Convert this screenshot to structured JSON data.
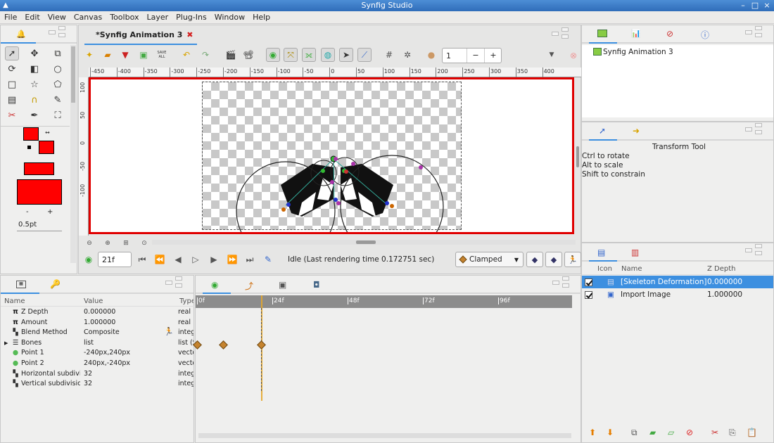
{
  "window": {
    "title": "Synfig Studio",
    "min": "–",
    "max": "□",
    "close": "×"
  },
  "menu": [
    "File",
    "Edit",
    "View",
    "Canvas",
    "Toolbox",
    "Layer",
    "Plug-Ins",
    "Window",
    "Help"
  ],
  "document_tab": {
    "label": "*Synfig Animation 3",
    "close": "✖"
  },
  "toolbar": {
    "save_all": "SAVE ALL",
    "onion_value": "1",
    "minus": "−",
    "plus": "+"
  },
  "ruler_h": [
    "-450",
    "-400",
    "-350",
    "-300",
    "-250",
    "-200",
    "-150",
    "-100",
    "-50",
    "0",
    "50",
    "100",
    "150",
    "200",
    "250",
    "300",
    "350",
    "400"
  ],
  "ruler_v": [
    "100",
    "50",
    "0",
    "-50",
    "-100"
  ],
  "colors": {
    "outline": "#ff0000",
    "fill": "#ff0000",
    "accent": "#3c8fe0",
    "canvas_border": "#e00000"
  },
  "brush_size": "0.5pt",
  "widths": {
    "minus": "-",
    "plus": "+"
  },
  "timebar": {
    "frame": "21f",
    "status": "Idle (Last rendering time 0.172751 sec)",
    "interpolation": "Clamped"
  },
  "params": {
    "headers": {
      "name": "Name",
      "value": "Value",
      "type": "Type"
    },
    "rows": [
      {
        "name": "Z Depth",
        "value": "0.000000",
        "type": "real",
        "icon": "pi-icon"
      },
      {
        "name": "Amount",
        "value": "1.000000",
        "type": "real",
        "icon": "pi-icon"
      },
      {
        "name": "Blend Method",
        "value": "Composite",
        "type": "integer",
        "icon": "blend-icon"
      },
      {
        "name": "Bones",
        "value": "list",
        "type": "list (Skeleton)",
        "icon": "list-icon"
      },
      {
        "name": "Point 1",
        "value": "-240px,240px",
        "type": "vector",
        "icon": "point-icon"
      },
      {
        "name": "Point 2",
        "value": "240px,-240px",
        "type": "vector",
        "icon": "point-icon"
      },
      {
        "name": "Horizontal subdivisions",
        "value": "32",
        "type": "integer",
        "icon": "blend-icon"
      },
      {
        "name": "Vertical subdivisions",
        "value": "32",
        "type": "integer",
        "icon": "blend-icon"
      }
    ]
  },
  "timetrack": {
    "marks": [
      "0f",
      "24f",
      "48f",
      "72f",
      "96f"
    ]
  },
  "canvas_browser": {
    "item": "Synfig Animation 3"
  },
  "tool_options": {
    "title": "Transform Tool",
    "lines": [
      "Ctrl to rotate",
      "Alt to scale",
      "Shift to constrain"
    ]
  },
  "layers": {
    "headers": {
      "icon": "Icon",
      "name": "Name",
      "zdepth": "Z Depth"
    },
    "rows": [
      {
        "name": "[Skeleton Deformation]",
        "zdepth": "0.000000",
        "selected": true
      },
      {
        "name": "Import Image",
        "zdepth": "1.000000",
        "selected": false
      }
    ]
  }
}
